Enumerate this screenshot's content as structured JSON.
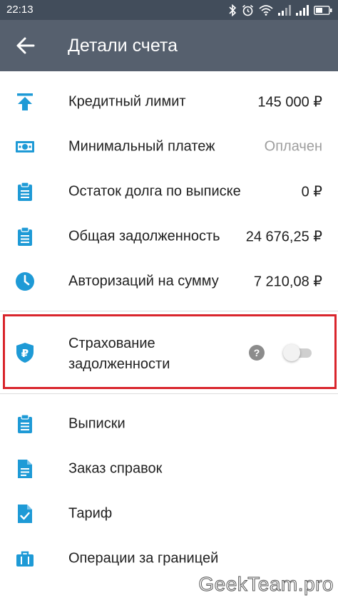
{
  "status_bar": {
    "time": "22:13"
  },
  "header": {
    "title": "Детали счета"
  },
  "colors": {
    "accent": "#1e9ad6",
    "appbar": "#56606e",
    "statusbar": "#424d5b",
    "highlight": "#d9252c"
  },
  "details": [
    {
      "icon": "arrow-up-bar-icon",
      "label": "Кредитный лимит",
      "value": "145 000 ₽"
    },
    {
      "icon": "banknote-icon",
      "label": "Минимальный платеж",
      "value": "Оплачен"
    },
    {
      "icon": "clipboard-icon",
      "label": "Остаток долга по выписке",
      "value": "0 ₽"
    },
    {
      "icon": "clipboard-icon",
      "label": "Общая задолженность",
      "value": "24 676,25 ₽"
    },
    {
      "icon": "clock-icon",
      "label": "Авторизаций на сумму",
      "value": "7 210,08 ₽"
    }
  ],
  "insurance": {
    "icon": "ruble-shield-icon",
    "line1": "Страхование",
    "line2": "задолженности",
    "help": "?",
    "enabled": false
  },
  "menu": [
    {
      "icon": "clipboard-icon",
      "label": "Выписки"
    },
    {
      "icon": "document-icon",
      "label": "Заказ справок"
    },
    {
      "icon": "checked-document-icon",
      "label": "Тариф"
    },
    {
      "icon": "briefcase-icon",
      "label": "Операции за границей"
    }
  ],
  "watermark": "GeekTeam.pro"
}
